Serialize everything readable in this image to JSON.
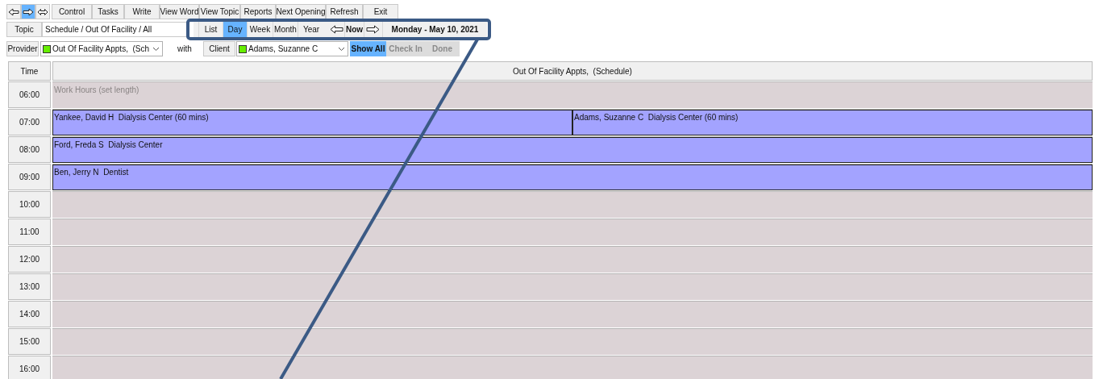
{
  "nav_buttons": [
    {
      "kind": "back",
      "selected": false
    },
    {
      "kind": "forward",
      "selected": true
    },
    {
      "kind": "both",
      "selected": false
    }
  ],
  "toolbar": [
    "Control",
    "Tasks",
    "Write",
    "View Word",
    "View Topic",
    "Reports",
    "Next Opening",
    "Refresh",
    "Exit"
  ],
  "topic": {
    "label": "Topic",
    "value": "Schedule / Out Of Facility / All"
  },
  "views": [
    {
      "label": "List",
      "selected": false
    },
    {
      "label": "Day",
      "selected": true
    },
    {
      "label": "Week",
      "selected": false
    },
    {
      "label": "Month",
      "selected": false
    },
    {
      "label": "Year",
      "selected": false
    }
  ],
  "now_label": "Now",
  "date": "Monday - May 10, 2021",
  "provider": {
    "label": "Provider",
    "value": "Out Of Facility Appts,  (Sch",
    "color": "#66ee00"
  },
  "with_label": "with",
  "client": {
    "label": "Client",
    "value": "Adams, Suzanne C",
    "color": "#66ee00"
  },
  "filters": [
    {
      "label": "Show All",
      "selected": true,
      "disabled": false
    },
    {
      "label": "Check In",
      "selected": false,
      "disabled": true
    },
    {
      "label": "Done",
      "selected": false,
      "disabled": true
    }
  ],
  "grid": {
    "time_header": "Time",
    "column_header": "Out Of Facility Appts,  (Schedule)",
    "rows": [
      {
        "time": "06:00",
        "events": [
          {
            "kind": "work_hours",
            "text": "Work Hours (set length)"
          }
        ]
      },
      {
        "time": "07:00",
        "events": [
          {
            "kind": "appointment",
            "text": "Yankee, David H  Dialysis Center (60 mins)"
          },
          {
            "kind": "appointment",
            "text": "Adams, Suzanne C  Dialysis Center (60 mins)"
          }
        ]
      },
      {
        "time": "08:00",
        "events": [
          {
            "kind": "appointment",
            "text": "Ford, Freda S  Dialysis Center"
          }
        ]
      },
      {
        "time": "09:00",
        "events": [
          {
            "kind": "appointment",
            "text": "Ben, Jerry N  Dentist"
          }
        ]
      },
      {
        "time": "10:00"
      },
      {
        "time": "11:00"
      },
      {
        "time": "12:00"
      },
      {
        "time": "13:00"
      },
      {
        "time": "14:00"
      },
      {
        "time": "15:00"
      },
      {
        "time": "16:00"
      }
    ]
  }
}
